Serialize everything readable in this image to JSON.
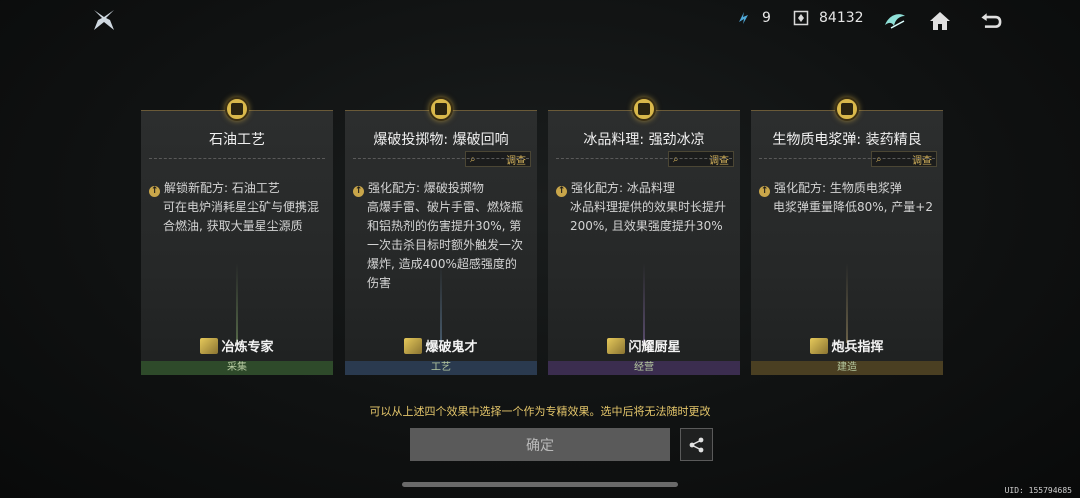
{
  "header": {
    "energy_value": "9",
    "credits_value": "84132"
  },
  "cards": [
    {
      "title": "石油工艺",
      "has_investigate": false,
      "effect_head": "解锁新配方: 石油工艺",
      "effect_body": "可在电炉消耗星尘矿与便携混合燃油, 获取大量星尘源质",
      "specialist": "冶炼专家",
      "category": "采集",
      "category_color": "#2e4a2a"
    },
    {
      "title": "爆破投掷物: 爆破回响",
      "has_investigate": true,
      "effect_head": "强化配方: 爆破投掷物",
      "effect_body": "高爆手雷、破片手雷、燃烧瓶和铝热剂的伤害提升30%, 第一次击杀目标时额外触发一次爆炸, 造成400%超感强度的伤害",
      "specialist": "爆破鬼才",
      "category": "工艺",
      "category_color": "#2a3a4f"
    },
    {
      "title": "冰品料理: 强劲冰凉",
      "has_investigate": true,
      "effect_head": "强化配方: 冰品料理",
      "effect_body": "冰品料理提供的效果时长提升200%, 且效果强度提升30%",
      "specialist": "闪耀厨星",
      "category": "经营",
      "category_color": "#3b2d4f"
    },
    {
      "title": "生物质电浆弹: 装药精良",
      "has_investigate": true,
      "effect_head": "强化配方: 生物质电浆弹",
      "effect_body": "电浆弹重量降低80%, 产量+2",
      "specialist": "炮兵指挥",
      "category": "建造",
      "category_color": "#4a3f22"
    }
  ],
  "investigate_label": "调查",
  "hint": "可以从上述四个效果中选择一个作为专精效果。选中后将无法随时更改",
  "confirm_label": "确定",
  "uid": "UID: 155794685",
  "colors": {
    "accent_gold": "#d4b25b",
    "button_disabled": "#5a5a5a"
  }
}
